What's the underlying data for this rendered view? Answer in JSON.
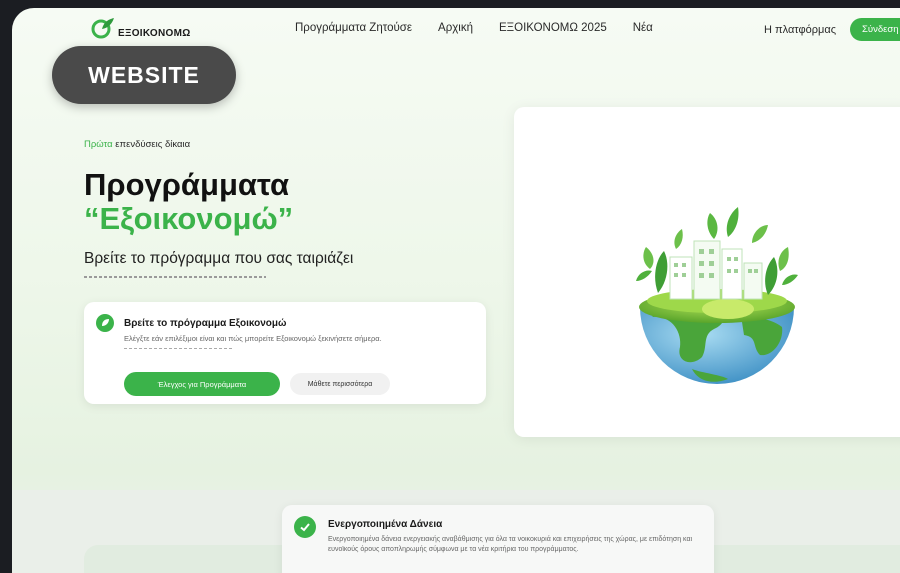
{
  "nav": {
    "logo_text": "ΕΞΟΙΚΟΝΟΜΩ",
    "links": [
      "Προγράμματα Ζητούσε",
      "Αρχική",
      "ΕΞΟΙΚΟΝΟΜΩ 2025",
      "Νέα"
    ],
    "platform_label": "Η πλατφόρμας",
    "cta_label": "Σύνδεση"
  },
  "badge": {
    "label": "WEBSITE"
  },
  "hero": {
    "eyebrow_green": "Πρώτα",
    "eyebrow_rest": " επενδύσεις δίκαια",
    "title_line1": "Προγράμματα",
    "title_line2": "“Εξοικονομώ”",
    "subtitle": "Βρείτε το πρόγραμμα που σας ταιριάζει"
  },
  "card": {
    "icon": "leaf-icon",
    "title": "Βρείτε το πρόγραμμα Εξοικονομώ",
    "text": "Ελέγξτε εάν επιλέξιμοι είναι και πώς μπορείτε Εξοικονομώ ξεκινήσετε σήμερα.",
    "primary_button": "Έλεγχος για Προγράμματα",
    "secondary_button": "Μάθετε περισσότερα"
  },
  "info": {
    "icon": "check-circle-icon",
    "title": "Ενεργοποιημένα Δάνεια",
    "text": "Ενεργοποιημένα δάνεια ενεργειακής αναβάθμισης για όλα τα νοικοκυριά και επιχειρήσεις της χώρας, με επιδότηση και ευνοϊκούς όρους αποπληρωμής σύμφωνα με τα νέα κριτήρια του προγράμματος."
  },
  "colors": {
    "accent": "#3bb34a",
    "badge_bg": "#4a4a4a",
    "text_dark": "#111111"
  }
}
